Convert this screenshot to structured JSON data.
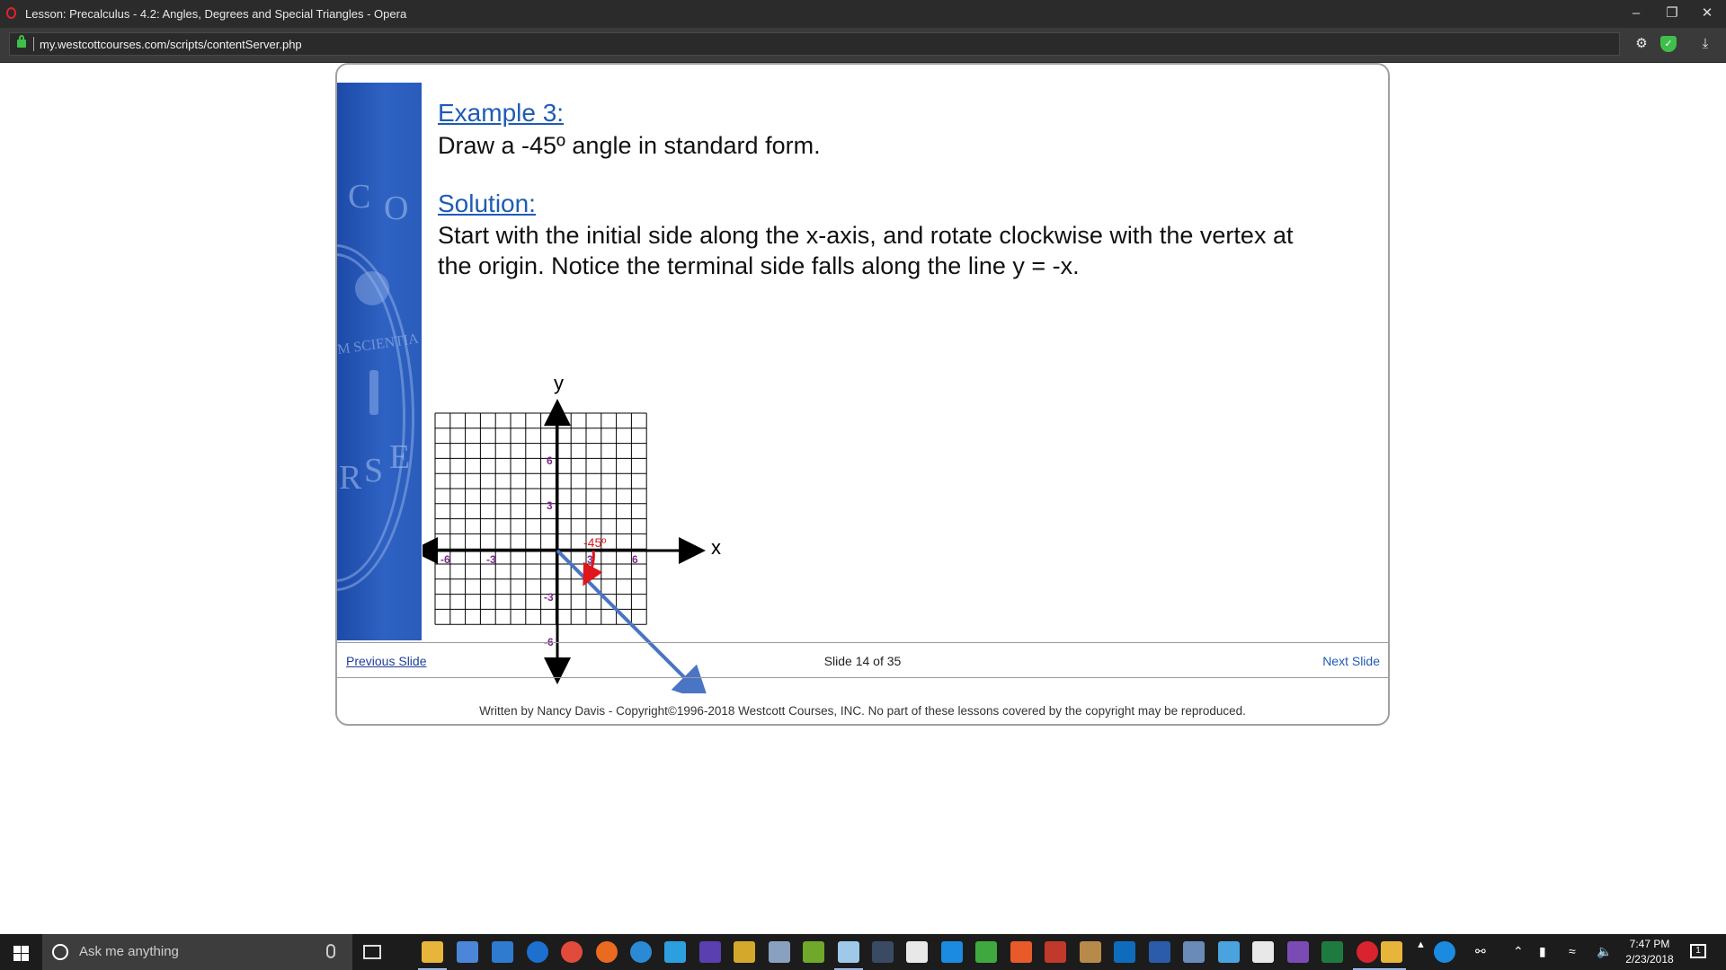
{
  "window": {
    "title": "Lesson: Precalculus - 4.2: Angles, Degrees and Special Triangles - Opera",
    "minimize": "–",
    "restore": "❐",
    "close": "✕"
  },
  "addressbar": {
    "url": "my.westcottcourses.com/scripts/contentServer.php"
  },
  "lesson": {
    "banner_letters": [
      "C",
      "O",
      "M SCIENTIA",
      "R",
      "S",
      "E"
    ],
    "example_heading": "Example 3:",
    "example_text": "Draw a -45º angle in standard form.",
    "solution_heading": "Solution:",
    "solution_line1": "Start with the initial side along the x-axis, and rotate clockwise with the vertex at",
    "solution_line2": "the origin.  Notice the terminal side falls along the line y = -x.",
    "graph": {
      "y_label": "y",
      "x_label": "x",
      "angle_label": "-45º",
      "x_ticks": [
        "-6",
        "-3",
        "3",
        "6"
      ],
      "y_ticks": [
        "6",
        "3",
        "-3",
        "-6"
      ],
      "terminal_line": "y = -x",
      "colors": {
        "terminal": "#4a74c4",
        "angle": "#e0161b",
        "tick": "#7a2a8a"
      }
    },
    "nav": {
      "previous": "Previous Slide",
      "counter": "Slide 14 of 35",
      "next": "Next Slide"
    },
    "copyright": "Written by Nancy Davis - Copyright©1996-2018 Westcott Courses, INC. No part of these lessons covered by the copyright may be reproduced."
  },
  "taskbar": {
    "search_placeholder": "Ask me anything",
    "time": "7:47 PM",
    "date": "2/23/2018",
    "notification_count": "1"
  }
}
